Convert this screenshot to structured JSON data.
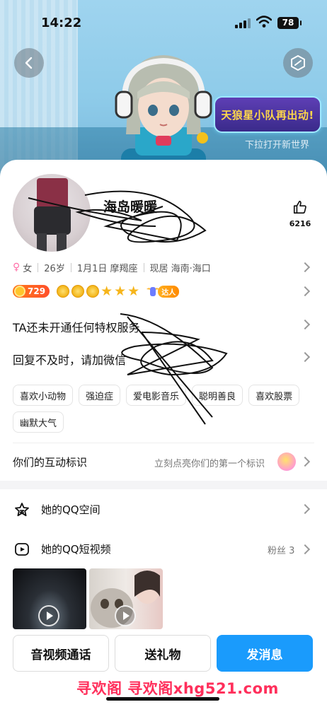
{
  "status_bar": {
    "time": "14:22",
    "battery": "78"
  },
  "header": {
    "banner_text": "天狼星小队再出动!",
    "banner_sub": "下拉打开新世界",
    "back_icon": "chevron-left-icon",
    "theme_icon": "hexagon-icon"
  },
  "profile": {
    "nickname": "海岛暖暖",
    "likes": "6216",
    "gender": "女",
    "age": "26岁",
    "birthday": "1月1日 摩羯座",
    "location": "现居 海南·海口",
    "level": "729",
    "daren_label": "达人"
  },
  "rows": {
    "privilege": "TA还未开通任何特权服务",
    "signature": "回复不及时，请加微信"
  },
  "tags": [
    "喜欢小动物",
    "强迫症",
    "爱电影音乐",
    "聪明善良",
    "喜欢股票",
    "幽默大气"
  ],
  "interaction": {
    "label": "你们的互动标识",
    "hint": "立刻点亮你们的第一个标识"
  },
  "qzone": {
    "label": "她的QQ空间"
  },
  "videos": {
    "label": "她的QQ短视频",
    "fans_label": "粉丝 3"
  },
  "actions": {
    "call": "音视频通话",
    "gift": "送礼物",
    "message": "发消息"
  },
  "watermark": "寻欢阁 寻欢阁xhg521.com",
  "colors": {
    "primary": "#1a9bfc",
    "banner_text": "#ffd84a",
    "watermark": "#ff2f5b",
    "level_pill": "#ff5a22"
  }
}
